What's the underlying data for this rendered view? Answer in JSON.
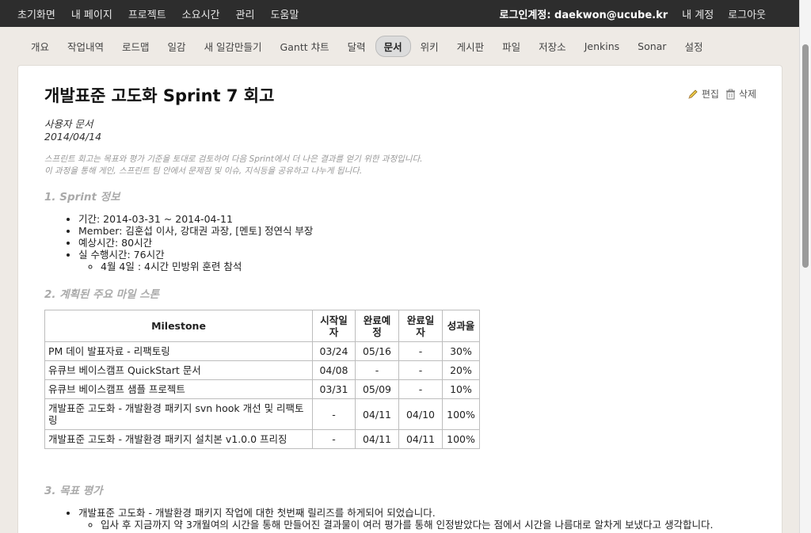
{
  "topnav": {
    "items": [
      "초기화면",
      "내 페이지",
      "프로젝트",
      "소요시간",
      "관리",
      "도움말"
    ],
    "login_label": "로그인계정: daekwon@ucube.kr",
    "account": "내 계정",
    "logout": "로그아웃"
  },
  "tabs": [
    "개요",
    "작업내역",
    "로드맵",
    "일감",
    "새 일감만들기",
    "Gantt 챠트",
    "달력",
    "문서",
    "위키",
    "게시판",
    "파일",
    "저장소",
    "Jenkins",
    "Sonar",
    "설정"
  ],
  "active_tab": "문서",
  "doc": {
    "title": "개발표준 고도화 Sprint 7 회고",
    "edit": "편집",
    "delete": "삭제",
    "category": "사용자 문서",
    "date": "2014/04/14",
    "intro": [
      "스프린트 회고는 목표와 평가 기준을 토대로 검토하여 다음 Sprint에서 더 나은 결과를 얻기 위한 과정입니다.",
      "이 과정을 통해 게인, 스프린트 팀 안에서 문제점 및 이슈, 지식등을 공유하고 나누게 됩니다."
    ],
    "section1": "1. Sprint 정보",
    "info": [
      "기간: 2014-03-31 ~ 2014-04-11",
      "Member: 김훈섭 이사, 강대권 과장, [멘토] 정연식 부장",
      "예상시간: 80시간",
      "실 수행시간: 76시간"
    ],
    "info_sub": "4월 4일 : 4시간 민방위 훈련 참석",
    "section2": "2. 계획된 주요 마일 스톤",
    "table": {
      "headers": [
        "Milestone",
        "시작일\n자",
        "완료예\n정",
        "완료일\n자",
        "성과율"
      ],
      "rows": [
        [
          "PM 데이 발표자료 - 리팩토링",
          "03/24",
          "05/16",
          "-",
          "30%"
        ],
        [
          "유큐브 베이스캠프 QuickStart 문서",
          "04/08",
          "-",
          "-",
          "20%"
        ],
        [
          "유큐브 베이스캠프 샘플 프로젝트",
          "03/31",
          "05/09",
          "-",
          "10%"
        ],
        [
          "개발표준 고도화 - 개발환경 패키지 svn hook 개선 및 리팩토링",
          "-",
          "04/11",
          "04/10",
          "100%"
        ],
        [
          "개발표준 고도화 - 개발환경 패키지 설치본 v1.0.0 프리징",
          "-",
          "04/11",
          "04/11",
          "100%"
        ]
      ]
    },
    "section3": "3. 목표 평가",
    "goal": "개발표준 고도화 - 개발환경 패키지 작업에 대한 첫번째 릴리즈를 하게되어 되었습니다.",
    "goal_sub": "입사 후 지금까지 약 3개월여의 시간을 통해 만들어진 결과물이 여러 평가를 통해 인정받았다는 점에서 시간을 나름대로 알차게 보냈다고 생각합니다."
  }
}
